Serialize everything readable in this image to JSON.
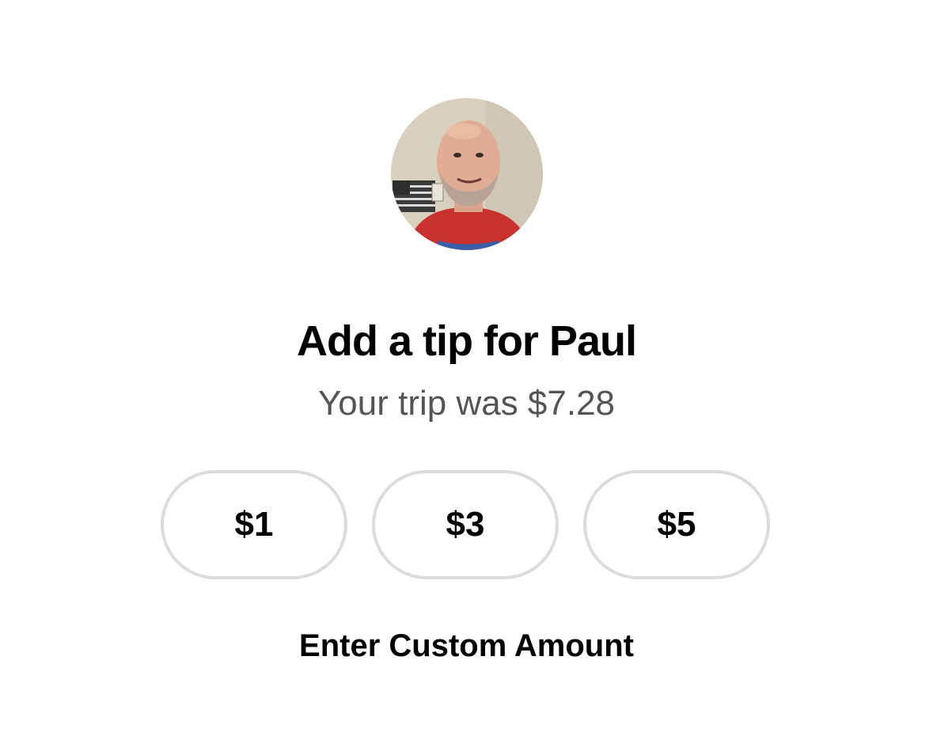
{
  "driver": {
    "avatar_alt": "Paul",
    "title": "Add a tip for Paul",
    "trip_summary": "Your trip was $7.28"
  },
  "tip_options": [
    {
      "label": "$1"
    },
    {
      "label": "$3"
    },
    {
      "label": "$5"
    }
  ],
  "custom_amount_label": "Enter Custom Amount",
  "colors": {
    "background": "#ffffff",
    "primary_text": "#000000",
    "secondary_text": "#545454",
    "button_border": "#dcdcdc"
  }
}
